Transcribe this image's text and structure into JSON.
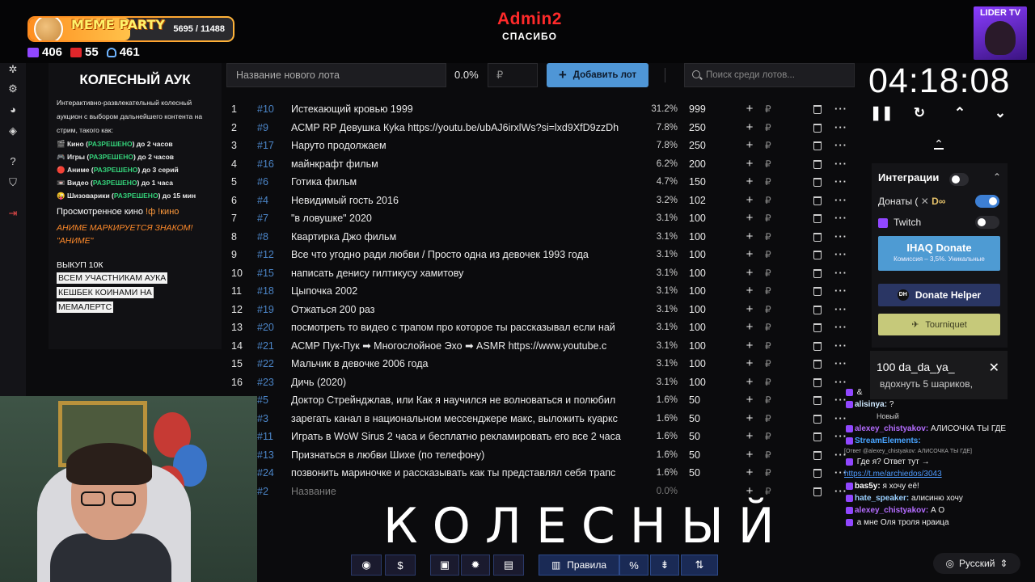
{
  "overlay": {
    "meme_party": {
      "title": "MEME PARTY",
      "count": "5695 / 11488",
      "progress": 0.4957
    },
    "stats": {
      "viewers_a": "406",
      "viewers_live": "55",
      "followers": "461"
    },
    "streamer": {
      "name": "Admin2",
      "message": "СПАСИБО"
    },
    "badge": "LIDER TV",
    "big_title": "КОЛЕСНЫЙ"
  },
  "description": {
    "heading": "КОЛЕСНЫЙ АУК",
    "intro": "Интерактивно-развлекательный колесный аукцион с выбором дальнейшего контента на стрим, такого как:",
    "rules": [
      {
        "icon": "🎬",
        "pre": "Кино (",
        "ok": "РАЗРЕШЕНО",
        "post": ") до 2 часов"
      },
      {
        "icon": "🎮",
        "pre": "Игры (",
        "ok": "РАЗРЕШЕНО",
        "post": ") до 2 часов"
      },
      {
        "icon": "🔴",
        "pre": "Аниме (",
        "ok": "РАЗРЕШЕНО",
        "post": ") до 3 серий"
      },
      {
        "icon": "📼",
        "pre": "Видео (",
        "ok": "РАЗРЕШЕНО",
        "post": ") до 1 часа"
      },
      {
        "icon": "😜",
        "pre": "Шизоварики (",
        "ok": "РАЗРЕШЕНО",
        "post": ") до 15 мин"
      }
    ],
    "watched_label": "Просмотренное кино",
    "watched_cmd": "!ф !кино",
    "anime_note": "АНИМЕ МАРКИРУЕТСЯ ЗНАКОМ! \"АНИМЕ\"",
    "buyout": "ВЫКУП 10К",
    "highlight_lines": [
      "ВСЕМ УЧАСТНИКАМ АУКА",
      "КЕШБЕК КОИНАМИ НА",
      "МЕМАЛЕРТС"
    ]
  },
  "lot_form": {
    "name_placeholder": "Название нового лота",
    "percent": "0.0%",
    "currency": "₽",
    "add_label": "Добавить лот",
    "search_placeholder": "Поиск среди лотов..."
  },
  "lots": [
    {
      "n": "1",
      "id": "#10",
      "name": "Истекающий кровью 1999",
      "pct": "31.2%",
      "sum": "999"
    },
    {
      "n": "2",
      "id": "#9",
      "name": "АСМР RP Девушка Куkа https://youtu.be/ubAJ6irxlWs?si=lxd9XfD9zzDh",
      "pct": "7.8%",
      "sum": "250"
    },
    {
      "n": "3",
      "id": "#17",
      "name": "Наруто продолжаем",
      "pct": "7.8%",
      "sum": "250"
    },
    {
      "n": "4",
      "id": "#16",
      "name": "майнкрафт фильм",
      "pct": "6.2%",
      "sum": "200"
    },
    {
      "n": "5",
      "id": "#6",
      "name": "Готика фильм",
      "pct": "4.7%",
      "sum": "150"
    },
    {
      "n": "6",
      "id": "#4",
      "name": "Невидимый гость 2016",
      "pct": "3.2%",
      "sum": "102"
    },
    {
      "n": "7",
      "id": "#7",
      "name": "\"в ловушке\" 2020",
      "pct": "3.1%",
      "sum": "100"
    },
    {
      "n": "8",
      "id": "#8",
      "name": "Квартирка Джо фильм",
      "pct": "3.1%",
      "sum": "100"
    },
    {
      "n": "9",
      "id": "#12",
      "name": "Все что угодно ради любви / Просто одна из девочек 1993 года",
      "pct": "3.1%",
      "sum": "100"
    },
    {
      "n": "10",
      "id": "#15",
      "name": "написать денису гилтикусу хамитову",
      "pct": "3.1%",
      "sum": "100"
    },
    {
      "n": "11",
      "id": "#18",
      "name": "Цыпочка 2002",
      "pct": "3.1%",
      "sum": "100"
    },
    {
      "n": "12",
      "id": "#19",
      "name": "Отжаться 200 раз",
      "pct": "3.1%",
      "sum": "100"
    },
    {
      "n": "13",
      "id": "#20",
      "name": "посмотреть то видео с трапом про которое ты рассказывал если най",
      "pct": "3.1%",
      "sum": "100"
    },
    {
      "n": "14",
      "id": "#21",
      "name": "АСМР Пук-Пук ➡ Многослойное Эхо ➡ ASMR https://www.youtube.c",
      "pct": "3.1%",
      "sum": "100"
    },
    {
      "n": "15",
      "id": "#22",
      "name": "Мальчик в девочке 2006 года",
      "pct": "3.1%",
      "sum": "100"
    },
    {
      "n": "16",
      "id": "#23",
      "name": "Дичь (2020)",
      "pct": "3.1%",
      "sum": "100"
    },
    {
      "n": "17",
      "id": "#5",
      "name": "Доктор Стрейнджлав, или Как я научился не волноваться и полюбил",
      "pct": "1.6%",
      "sum": "50"
    },
    {
      "n": "18",
      "id": "#3",
      "name": "зарегать канал в национальном мессенджере макс, выложить куаркс",
      "pct": "1.6%",
      "sum": "50"
    },
    {
      "n": "19",
      "id": "#11",
      "name": "Играть в WoW Sirus 2 часа и бесплатно рекламировать его все 2 часа",
      "pct": "1.6%",
      "sum": "50"
    },
    {
      "n": "20",
      "id": "#13",
      "name": "Признаться в любви Шихе (по телефону)",
      "pct": "1.6%",
      "sum": "50"
    },
    {
      "n": "21",
      "id": "#24",
      "name": "позвонить мариночке и рассказывать как ты представлял себя трапс",
      "pct": "1.6%",
      "sum": "50"
    },
    {
      "n": "22",
      "id": "#2",
      "name": "Название",
      "pct": "0.0%",
      "sum": ""
    }
  ],
  "timer": {
    "value": "04:18:08"
  },
  "integrations": {
    "title": "Интеграции",
    "donations_label": "Донаты (",
    "twitch_label": "Twitch",
    "ihaq_title": "IHAQ Donate",
    "ihaq_sub": "Комиссия – 3,5%. Уникальные",
    "donate_helper": "Donate Helper",
    "tourniquet": "Tourniquet",
    "donations_enabled": true,
    "twitch_enabled": false
  },
  "toast": {
    "title": "100 da_da_ya_",
    "text": "вдохнуть 5 шариков,"
  },
  "chat": [
    {
      "user": "",
      "text": "& ",
      "color": "#ffffff"
    },
    {
      "user": "alisinya:",
      "text": "?",
      "color": "#cfe9ff"
    },
    {
      "user": "alexey_chistyakov:",
      "text": "АЛИСОЧКА ТЫ ГДЕ",
      "color": "#b46cff"
    },
    {
      "user": "StreamElements:",
      "text": "",
      "color": "#49a4ff"
    },
    {
      "user": "",
      "text": "Где я? Ответ тут →",
      "color": "#ffffff"
    },
    {
      "user": "bas5y:",
      "text": "я хочу её!",
      "color": "#ffffff"
    },
    {
      "user": "hate_speaker:",
      "text": "алисиню хочу",
      "color": "#9ad0ff"
    },
    {
      "user": "alexey_chistyakov:",
      "text": "А О",
      "color": "#b46cff"
    },
    {
      "user": "",
      "text": "а мне Оля троля нраица",
      "color": "#ffffff"
    }
  ],
  "chat_extra": {
    "reply_note": "[Ответ @alexey_chistyakov: АЛИСОЧКА ТЫ ГДЕ]",
    "link": "https://t.me/archiedos/3043",
    "new_label": "Новый"
  },
  "language": "Русский",
  "toolbar": {
    "rules_label": "Правила"
  }
}
